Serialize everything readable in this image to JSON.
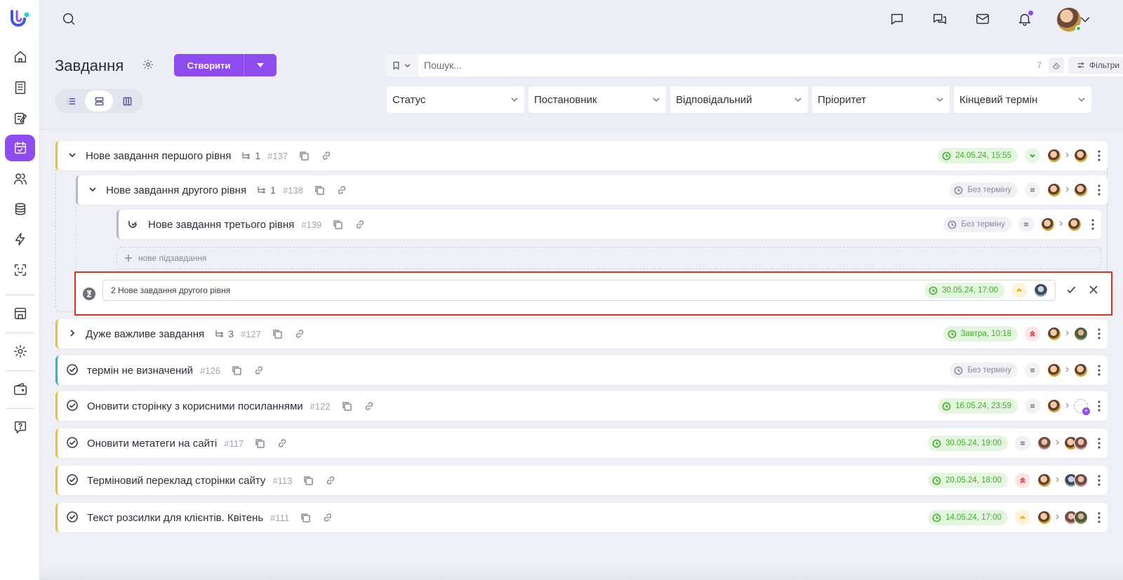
{
  "page": {
    "title": "Завдання",
    "create_label": "Створити",
    "search_placeholder": "Пошук...",
    "search_count": "7",
    "filters_label": "Фільтри"
  },
  "filters": [
    "Статус",
    "Постановник",
    "Відповідальний",
    "Пріоритет",
    "Кінцевий термін"
  ],
  "new_subtask_label": "нове підзавдання",
  "editing": {
    "value": "2 Нове завдання другого рівня",
    "deadline": "30.05.24, 17:00"
  },
  "tasks": [
    {
      "title": "Нове завдання першого рівня",
      "subcount": "1",
      "id": "#137",
      "deadline": "24.05.24, 15:55"
    },
    {
      "title": "Нове завдання другого рівня",
      "subcount": "1",
      "id": "#138",
      "deadline": "Без терміну"
    },
    {
      "title": "Нове завдання третього рівня",
      "id": "#139",
      "deadline": "Без терміну"
    },
    {
      "title": "Дуже важливе завдання",
      "subcount": "3",
      "id": "#127",
      "deadline": "Завтра, 10:18"
    },
    {
      "title": "термін не визначений",
      "id": "#126",
      "deadline": "Без терміну"
    },
    {
      "title": "Оновити сторінку з корисними посиланнями",
      "id": "#122",
      "deadline": "16.05.24, 23:59"
    },
    {
      "title": "Оновити метатеги на сайті",
      "id": "#117",
      "deadline": "30.05.24, 19:00"
    },
    {
      "title": "Терміновий переклад сторінки сайту",
      "id": "#113",
      "deadline": "20.05.24, 18:00"
    },
    {
      "title": "Текст розсилки для клієнтів. Квітень",
      "id": "#111",
      "deadline": "14.05.24, 17:00"
    }
  ],
  "colors": {
    "accent": "#8e4cf0",
    "highlight_border": "#e0301e",
    "deadline_green": "#3fae2a",
    "task_border_yellow": "#f2c224",
    "task_border_blue": "#2bb5d9"
  },
  "icons": {
    "sidebar": [
      "home-icon",
      "building-icon",
      "edit-list-icon",
      "calendar-check-icon",
      "users-icon",
      "database-icon",
      "lightning-icon",
      "scan-icon",
      "store-icon",
      "gear-icon",
      "wallet-icon",
      "help-icon"
    ],
    "topbar": [
      "search-icon",
      "chat-icon",
      "messages-icon",
      "mail-icon",
      "bell-icon",
      "chevron-down-icon"
    ]
  }
}
